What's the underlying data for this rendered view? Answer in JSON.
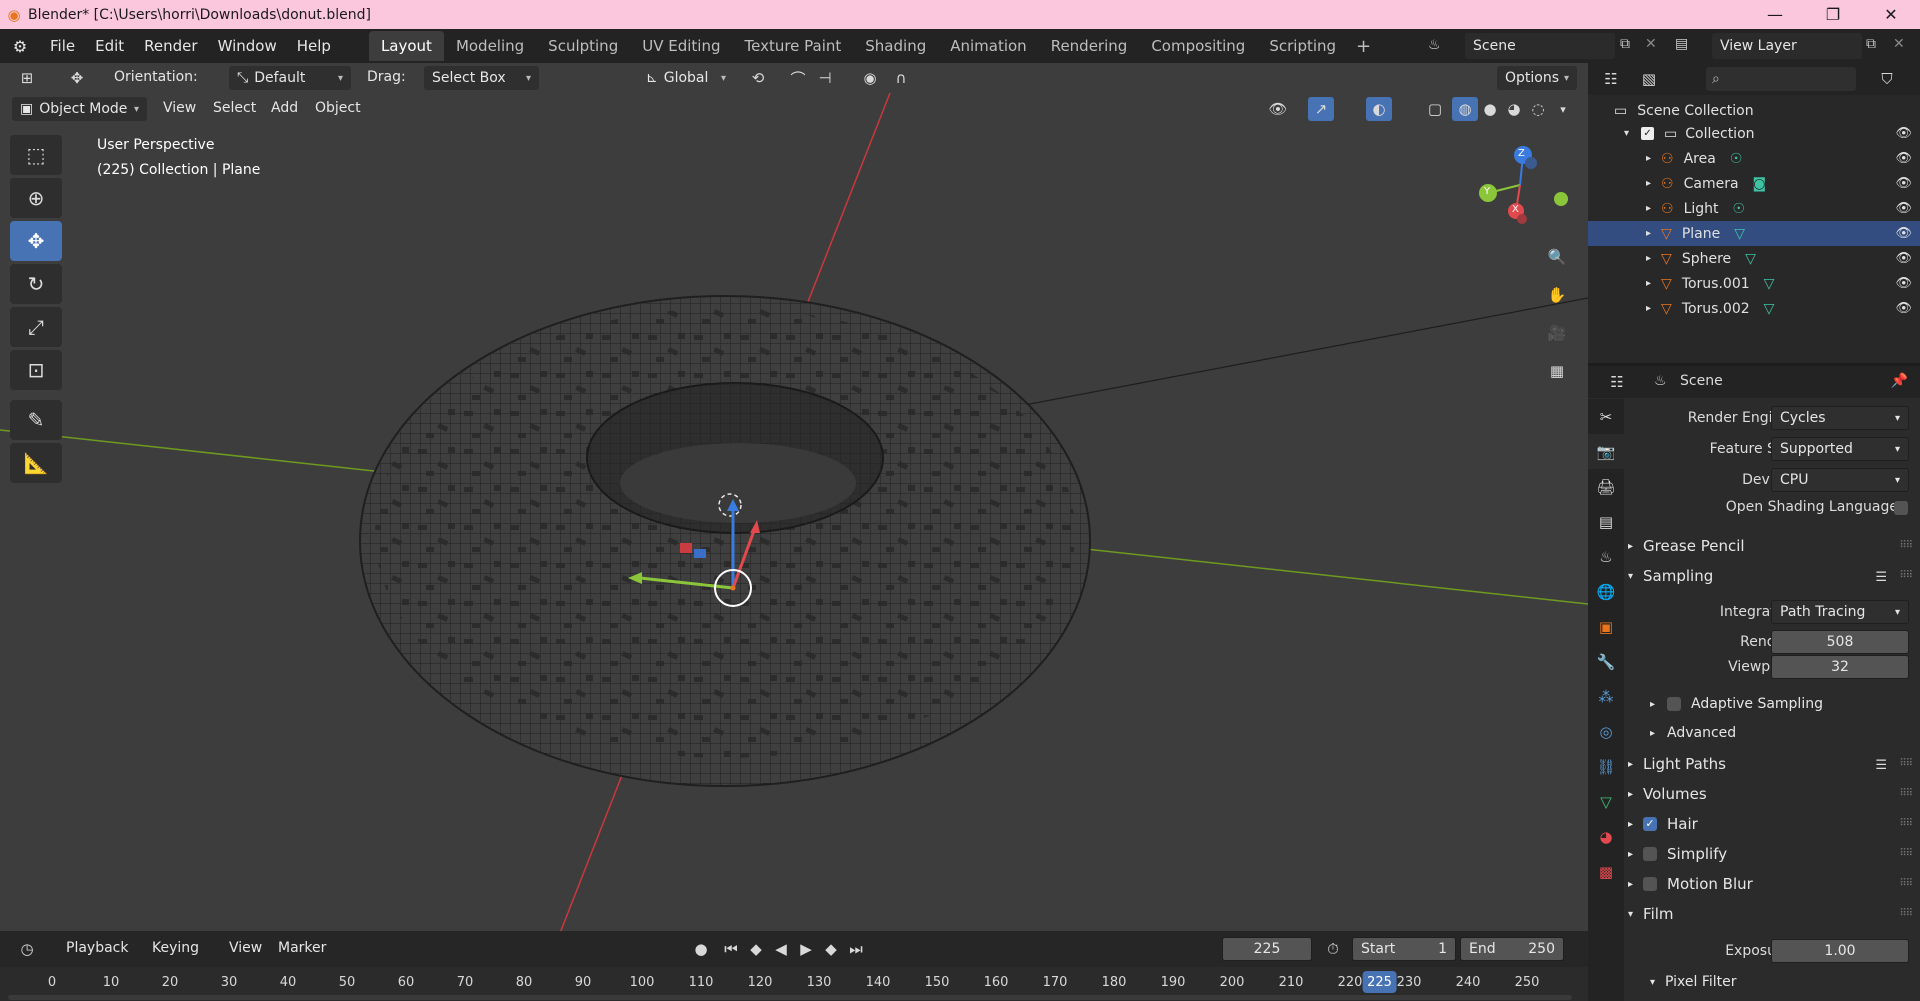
{
  "titlebar": {
    "title": "Blender* [C:\\Users\\horri\\Downloads\\donut.blend]"
  },
  "menu": [
    "File",
    "Edit",
    "Render",
    "Window",
    "Help"
  ],
  "workspaces": [
    "Layout",
    "Modeling",
    "Sculpting",
    "UV Editing",
    "Texture Paint",
    "Shading",
    "Animation",
    "Rendering",
    "Compositing",
    "Scripting"
  ],
  "scene": {
    "scene_name": "Scene",
    "view_layer": "View Layer"
  },
  "viewport": {
    "orientation_label": "Orientation:",
    "orientation_value": "Default",
    "drag_label": "Drag:",
    "drag_value": "Select Box",
    "transform_orientation": "Global",
    "options": "Options",
    "mode": "Object Mode",
    "header_menus": [
      "View",
      "Select",
      "Add",
      "Object"
    ],
    "overlay_line1": "User Perspective",
    "overlay_line2": "(225) Collection | Plane",
    "gizmo": {
      "x": "X",
      "y": "Y",
      "z": "Z"
    }
  },
  "timeline": {
    "menus": [
      "Playback",
      "Keying",
      "View",
      "Marker"
    ],
    "current_frame": "225",
    "start_label": "Start",
    "start": "1",
    "end_label": "End",
    "end": "250",
    "ruler": [
      "0",
      "10",
      "20",
      "30",
      "40",
      "50",
      "60",
      "70",
      "80",
      "90",
      "100",
      "110",
      "120",
      "130",
      "140",
      "150",
      "160",
      "170",
      "180",
      "190",
      "200",
      "210",
      "220",
      "230",
      "240",
      "250"
    ],
    "playhead": "225"
  },
  "outliner": {
    "root": "Scene Collection",
    "collection": "Collection",
    "items": [
      {
        "name": "Area",
        "icon": "light-icon"
      },
      {
        "name": "Camera",
        "icon": "camera-icon"
      },
      {
        "name": "Light",
        "icon": "light-icon"
      },
      {
        "name": "Plane",
        "icon": "mesh-icon",
        "selected": true
      },
      {
        "name": "Sphere",
        "icon": "mesh-icon"
      },
      {
        "name": "Torus.001",
        "icon": "mesh-icon"
      },
      {
        "name": "Torus.002",
        "icon": "mesh-icon"
      }
    ]
  },
  "properties": {
    "context": "Scene",
    "render_engine_label": "Render Engine",
    "render_engine": "Cycles",
    "feature_set_label": "Feature Set",
    "feature_set": "Supported",
    "device_label": "Device",
    "device": "CPU",
    "osl_label": "Open Shading Language",
    "grease_pencil": "Grease Pencil",
    "sampling": "Sampling",
    "integrator_label": "Integrator",
    "integrator": "Path Tracing",
    "render_label": "Render",
    "render_samples": "508",
    "viewport_label": "Viewport",
    "viewport_samples": "32",
    "adaptive": "Adaptive Sampling",
    "advanced": "Advanced",
    "light_paths": "Light Paths",
    "volumes": "Volumes",
    "hair": "Hair",
    "simplify": "Simplify",
    "motion_blur": "Motion Blur",
    "film": "Film",
    "exposure_label": "Exposure",
    "exposure": "1.00",
    "pixel_filter": "Pixel Filter"
  },
  "colors": {
    "accent": "#4772b3",
    "title_bg": "#fbc7dc",
    "viewport_bg": "#3d3d3d",
    "axis_x": "#c9383d",
    "axis_y": "#6e9a1f"
  }
}
